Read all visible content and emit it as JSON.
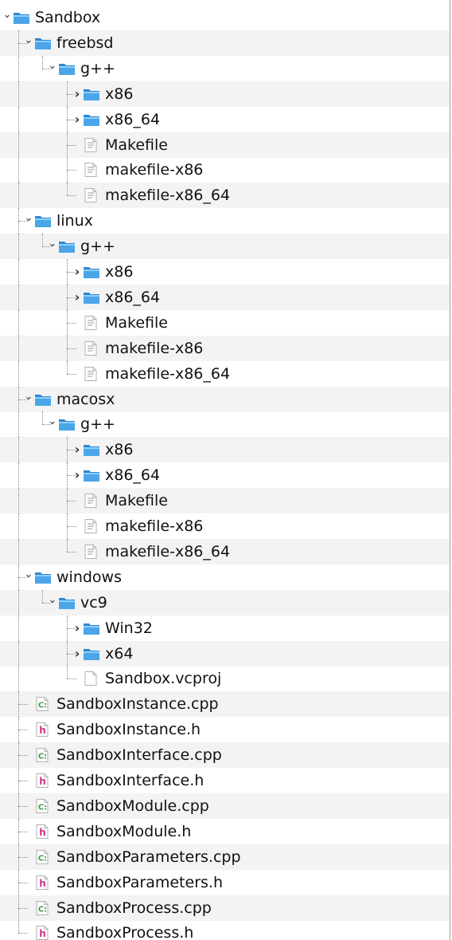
{
  "tree": {
    "items": [
      {
        "label": "Sandbox",
        "depth": 0,
        "kind": "folder",
        "state": "expanded",
        "last": false
      },
      {
        "label": "freebsd",
        "depth": 1,
        "kind": "folder",
        "state": "expanded",
        "last": false
      },
      {
        "label": "g++",
        "depth": 2,
        "kind": "folder",
        "state": "expanded",
        "last": true
      },
      {
        "label": "x86",
        "depth": 3,
        "kind": "folder",
        "state": "collapsed",
        "last": false
      },
      {
        "label": "x86_64",
        "depth": 3,
        "kind": "folder",
        "state": "collapsed",
        "last": false
      },
      {
        "label": "Makefile",
        "depth": 3,
        "kind": "text-file",
        "state": "leaf",
        "last": false
      },
      {
        "label": "makefile-x86",
        "depth": 3,
        "kind": "text-file",
        "state": "leaf",
        "last": false
      },
      {
        "label": "makefile-x86_64",
        "depth": 3,
        "kind": "text-file",
        "state": "leaf",
        "last": true
      },
      {
        "label": "linux",
        "depth": 1,
        "kind": "folder",
        "state": "expanded",
        "last": false
      },
      {
        "label": "g++",
        "depth": 2,
        "kind": "folder",
        "state": "expanded",
        "last": true
      },
      {
        "label": "x86",
        "depth": 3,
        "kind": "folder",
        "state": "collapsed",
        "last": false
      },
      {
        "label": "x86_64",
        "depth": 3,
        "kind": "folder",
        "state": "collapsed",
        "last": false
      },
      {
        "label": "Makefile",
        "depth": 3,
        "kind": "text-file",
        "state": "leaf",
        "last": false
      },
      {
        "label": "makefile-x86",
        "depth": 3,
        "kind": "text-file",
        "state": "leaf",
        "last": false
      },
      {
        "label": "makefile-x86_64",
        "depth": 3,
        "kind": "text-file",
        "state": "leaf",
        "last": true
      },
      {
        "label": "macosx",
        "depth": 1,
        "kind": "folder",
        "state": "expanded",
        "last": false
      },
      {
        "label": "g++",
        "depth": 2,
        "kind": "folder",
        "state": "expanded",
        "last": true
      },
      {
        "label": "x86",
        "depth": 3,
        "kind": "folder",
        "state": "collapsed",
        "last": false
      },
      {
        "label": "x86_64",
        "depth": 3,
        "kind": "folder",
        "state": "collapsed",
        "last": false
      },
      {
        "label": "Makefile",
        "depth": 3,
        "kind": "text-file",
        "state": "leaf",
        "last": false
      },
      {
        "label": "makefile-x86",
        "depth": 3,
        "kind": "text-file",
        "state": "leaf",
        "last": false
      },
      {
        "label": "makefile-x86_64",
        "depth": 3,
        "kind": "text-file",
        "state": "leaf",
        "last": true
      },
      {
        "label": "windows",
        "depth": 1,
        "kind": "folder",
        "state": "expanded",
        "last": false
      },
      {
        "label": "vc9",
        "depth": 2,
        "kind": "folder",
        "state": "expanded",
        "last": true
      },
      {
        "label": "Win32",
        "depth": 3,
        "kind": "folder",
        "state": "collapsed",
        "last": false
      },
      {
        "label": "x64",
        "depth": 3,
        "kind": "folder",
        "state": "collapsed",
        "last": false
      },
      {
        "label": "Sandbox.vcproj",
        "depth": 3,
        "kind": "xml-file",
        "state": "leaf",
        "last": true
      },
      {
        "label": "SandboxInstance.cpp",
        "depth": 1,
        "kind": "cpp-file",
        "state": "leaf",
        "last": false
      },
      {
        "label": "SandboxInstance.h",
        "depth": 1,
        "kind": "header-file",
        "state": "leaf",
        "last": false
      },
      {
        "label": "SandboxInterface.cpp",
        "depth": 1,
        "kind": "cpp-file",
        "state": "leaf",
        "last": false
      },
      {
        "label": "SandboxInterface.h",
        "depth": 1,
        "kind": "header-file",
        "state": "leaf",
        "last": false
      },
      {
        "label": "SandboxModule.cpp",
        "depth": 1,
        "kind": "cpp-file",
        "state": "leaf",
        "last": false
      },
      {
        "label": "SandboxModule.h",
        "depth": 1,
        "kind": "header-file",
        "state": "leaf",
        "last": false
      },
      {
        "label": "SandboxParameters.cpp",
        "depth": 1,
        "kind": "cpp-file",
        "state": "leaf",
        "last": false
      },
      {
        "label": "SandboxParameters.h",
        "depth": 1,
        "kind": "header-file",
        "state": "leaf",
        "last": false
      },
      {
        "label": "SandboxProcess.cpp",
        "depth": 1,
        "kind": "cpp-file",
        "state": "leaf",
        "last": false
      },
      {
        "label": "SandboxProcess.h",
        "depth": 1,
        "kind": "header-file",
        "state": "leaf",
        "last": true
      }
    ],
    "icons": {
      "folder": "folder-icon",
      "text-file": "text-file-icon",
      "xml-file": "xml-file-icon",
      "cpp-file": "cpp-file-icon",
      "header-file": "header-file-icon"
    },
    "glyphs": {
      "expanded": "⌄",
      "collapsed": "›",
      "cpp_badge": "C:",
      "header_badge": "h",
      "xml_badge": "</>"
    },
    "colors": {
      "folder_fill": "#4aa6e8",
      "folder_tab": "#2f86cf",
      "file_gray": "#b0b0b0",
      "cpp_green": "#3aa046",
      "header_pink": "#d0308a",
      "xml_red": "#d05050",
      "guide_line": "#8a8a8a",
      "alt_row": "#f3f3f3"
    }
  }
}
